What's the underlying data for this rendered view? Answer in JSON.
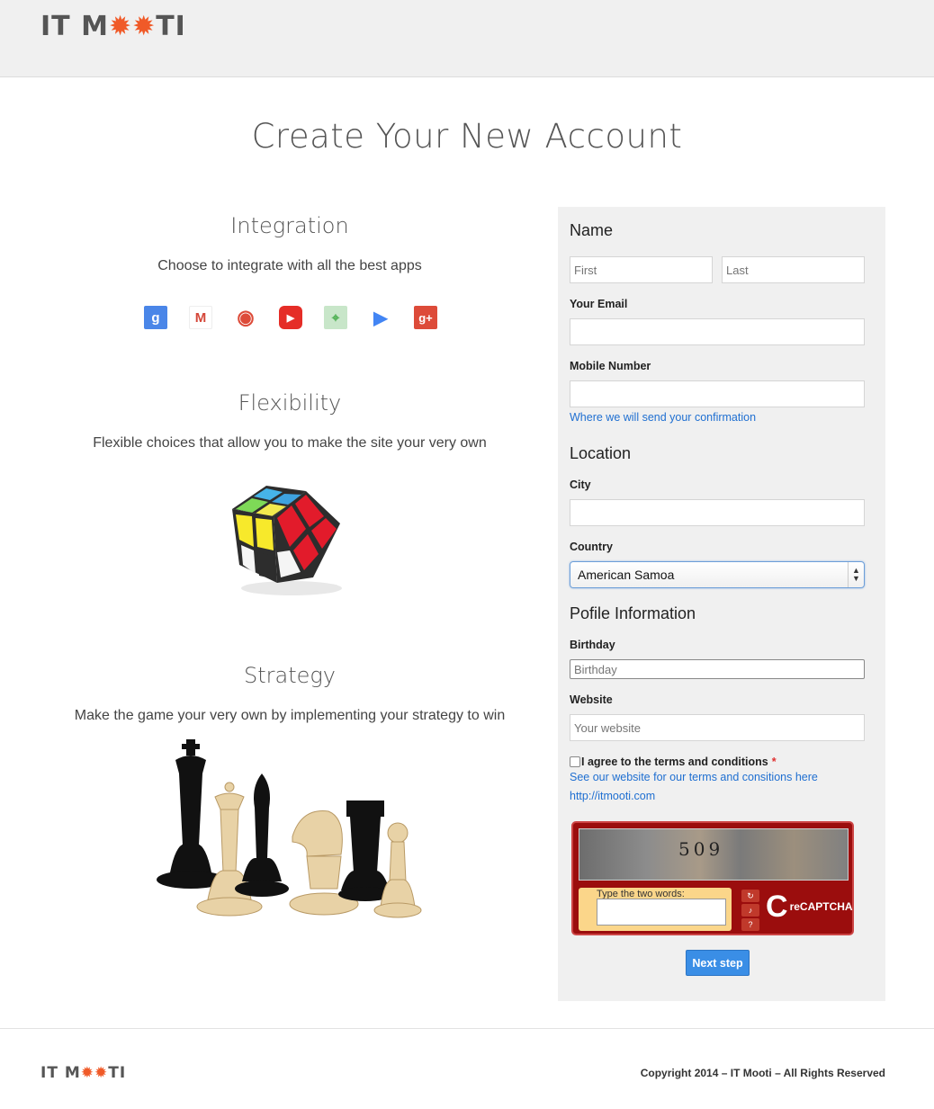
{
  "header": {
    "logo_prefix": "IT M",
    "logo_gears": "✹✹",
    "logo_suffix": "TI"
  },
  "page_title": "Create Your New Account",
  "features": [
    {
      "title": "Integration",
      "text": "Choose to integrate with all the best apps"
    },
    {
      "title": "Flexibility",
      "text": "Flexible choices that allow you to make the site your very own"
    },
    {
      "title": "Strategy",
      "text": "Make the game your very own by implementing your strategy to win"
    }
  ],
  "apps": [
    {
      "icon": "google-search-icon",
      "glyph": "g",
      "color": "#4a86e8"
    },
    {
      "icon": "gmail-icon",
      "glyph": "M",
      "color": "#d44638"
    },
    {
      "icon": "chrome-icon",
      "glyph": "◉",
      "color": "#dd4b39"
    },
    {
      "icon": "youtube-icon",
      "glyph": "▶",
      "color": "#e52d27"
    },
    {
      "icon": "google-maps-icon",
      "glyph": "⌖",
      "color": "#4caf50"
    },
    {
      "icon": "google-play-icon",
      "glyph": "▶",
      "color": "#4285f4"
    },
    {
      "icon": "google-plus-icon",
      "glyph": "g+",
      "color": "#dd4b39"
    }
  ],
  "form": {
    "name_heading": "Name",
    "first_placeholder": "First",
    "last_placeholder": "Last",
    "email_label": "Your Email",
    "mobile_label": "Mobile Number",
    "mobile_help": "Where we will send your confirmation",
    "location_heading": "Location",
    "city_label": "City",
    "country_label": "Country",
    "country_value": "American Samoa",
    "profile_heading": "Pofile Information",
    "birthday_label": "Birthday",
    "birthday_placeholder": "Birthday",
    "website_label": "Website",
    "website_placeholder": "Your website",
    "agree_label": "I agree to the terms and conditions",
    "required_mark": "*",
    "terms_text": "See our website for our terms and consitions here",
    "terms_url": "http://itmooti.com",
    "captcha_label": "Type the two words:",
    "captcha_digits": "509",
    "recaptcha_brand": "reCAPTCHA",
    "next_button": "Next step"
  },
  "footer": {
    "logo_prefix": "IT M",
    "logo_gears": "✹✹",
    "logo_suffix": "TI",
    "copyright": "Copyright 2014 – IT Mooti – All Rights Reserved"
  }
}
